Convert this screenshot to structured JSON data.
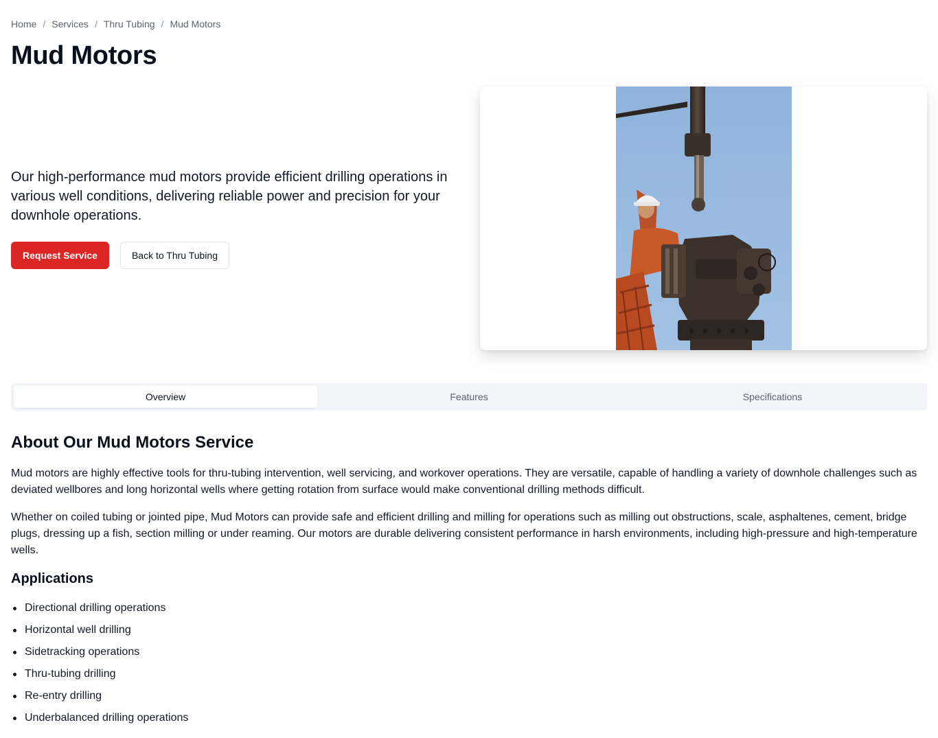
{
  "breadcrumb": {
    "items": [
      "Home",
      "Services",
      "Thru Tubing",
      "Mud Motors"
    ],
    "separator": "/"
  },
  "page_title": "Mud Motors",
  "hero": {
    "description": "Our high-performance mud motors provide efficient drilling operations in various well conditions, delivering reliable power and precision for your downhole operations.",
    "primary_button": "Request Service",
    "secondary_button": "Back to Thru Tubing",
    "image_alt": "Worker in hard hat at wellhead"
  },
  "tabs": [
    {
      "label": "Overview",
      "active": true
    },
    {
      "label": "Features",
      "active": false
    },
    {
      "label": "Specifications",
      "active": false
    }
  ],
  "overview": {
    "title": "About Our Mud Motors Service",
    "paragraphs": [
      "Mud motors are highly effective tools for thru-tubing intervention, well servicing, and workover operations. They are versatile, capable of handling a variety of downhole challenges such as deviated wellbores and long horizontal wells where getting rotation from surface would make conventional drilling methods difficult.",
      "Whether on coiled tubing or jointed pipe, Mud Motors can provide safe and efficient drilling and milling for operations such as milling out obstructions, scale, asphaltenes, cement, bridge plugs, dressing up a fish, section milling or under reaming. Our motors are durable delivering consistent performance in harsh environments, including high-pressure and high-temperature wells."
    ],
    "applications_title": "Applications",
    "applications": [
      "Directional drilling operations",
      "Horizontal well drilling",
      "Sidetracking operations",
      "Thru-tubing drilling",
      "Re-entry drilling",
      "Underbalanced drilling operations"
    ]
  },
  "colors": {
    "accent": "#dc2626",
    "tab_bg": "#f1f4f8",
    "text": "#121826",
    "muted": "#5b6473"
  }
}
